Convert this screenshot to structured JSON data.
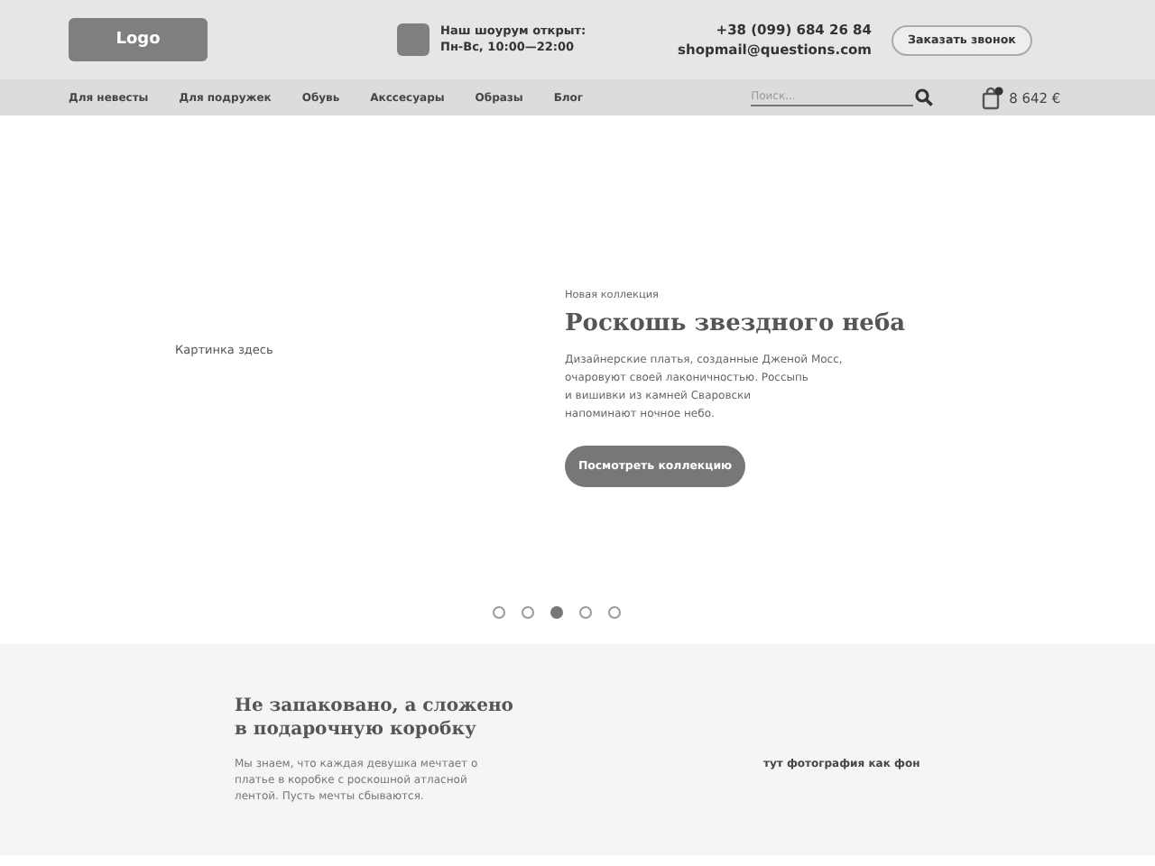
{
  "header": {
    "logo": "Logo",
    "showroom": {
      "title": "Наш шоурум открыт:",
      "hours": "Пн-Вс, 10:00—22:00"
    },
    "phone": "+38 (099) 684 26 84",
    "email": "shopmail@questions.com",
    "callback_button": "Заказать звонок"
  },
  "nav": {
    "items": [
      "Для невесты",
      "Для подружек",
      "Обувь",
      "Акссесуары",
      "Образы",
      "Блог"
    ],
    "search": {
      "placeholder": "Поиск..."
    },
    "cart_total": "8 642 €"
  },
  "hero": {
    "picture_placeholder": "Картинка здесь",
    "kicker": "Новая коллекция",
    "title": "Роскошь звездного неба",
    "lines": [
      "Дизайнерские платья, созданные Дженой Мосс,",
      "очаровуют своей лаконичностью. Россыпь",
      "и вишивки из камней Сваровски",
      "напоминают ночное  небо."
    ],
    "button": "Посмотреть коллекцию",
    "dots": [
      {
        "selected": false
      },
      {
        "selected": false
      },
      {
        "selected": true
      },
      {
        "selected": false
      },
      {
        "selected": false
      }
    ]
  },
  "gift": {
    "title_lines": [
      "Не запаковано, а сложено",
      "в подарочную коробку"
    ],
    "text_lines": [
      "Мы знаем, что каждая девушка мечтает о",
      "платье в коробке с роскошной атласной",
      "лентой. Пусть мечты сбываются."
    ],
    "photo_placeholder": "тут фотография как фон"
  }
}
